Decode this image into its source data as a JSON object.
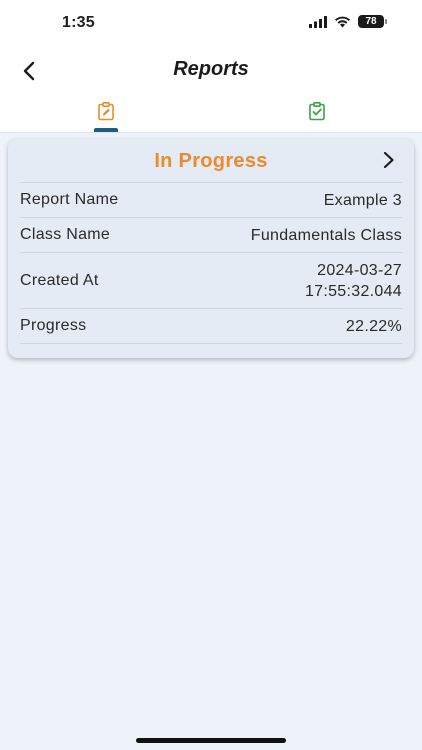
{
  "status_bar": {
    "time": "1:35",
    "battery": "78"
  },
  "header": {
    "title": "Reports"
  },
  "tabs": [
    {
      "name": "in-progress",
      "icon": "clipboard-edit-icon",
      "color": "#ec8a2c",
      "active": true
    },
    {
      "name": "completed",
      "icon": "clipboard-check-icon",
      "color": "#3aa346",
      "active": false
    }
  ],
  "report": {
    "status": "In Progress",
    "status_color": "#ec8a2c",
    "fields": [
      {
        "label": "Report Name",
        "value": "Example 3"
      },
      {
        "label": "Class Name",
        "value": "Fundamentals Class"
      },
      {
        "label": "Created At",
        "value_line1": "2024-03-27",
        "value_line2": "17:55:32.044"
      },
      {
        "label": "Progress",
        "value": "22.22%"
      }
    ]
  }
}
